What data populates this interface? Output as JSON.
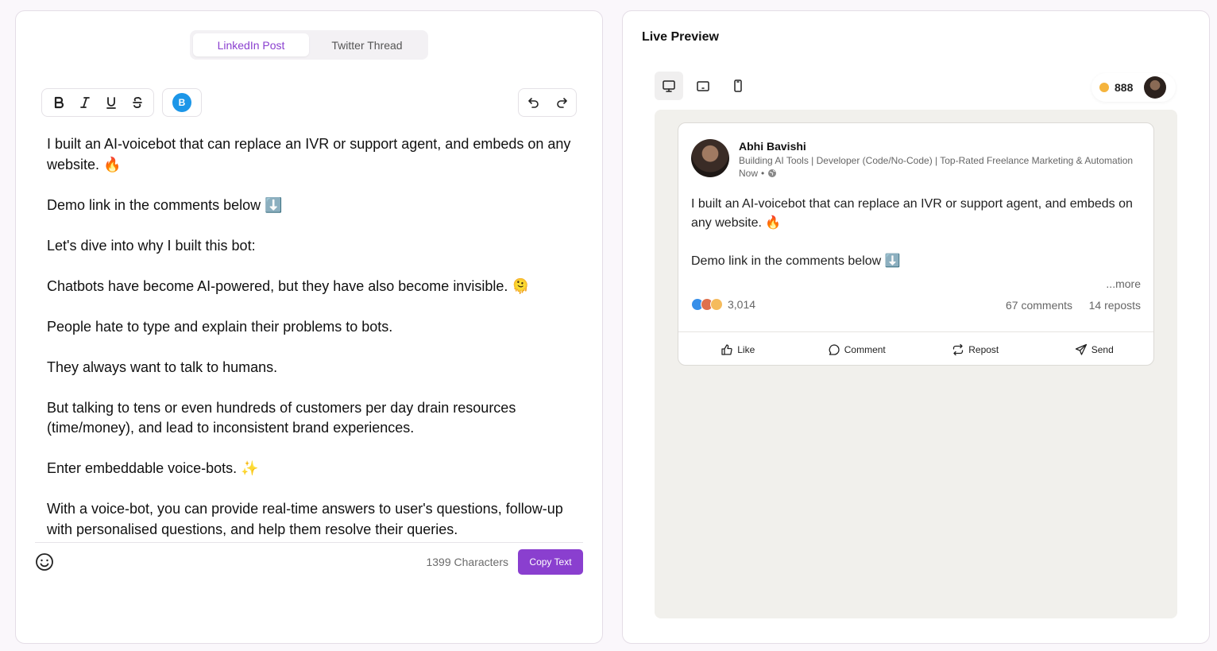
{
  "tabs": {
    "linkedin": "LinkedIn Post",
    "twitter": "Twitter Thread"
  },
  "toolbar": {
    "bold_icon": "bold-icon",
    "italic_icon": "italic-icon",
    "underline_icon": "underline-icon",
    "strikethrough_icon": "strikethrough-icon",
    "bold_font_label": "B",
    "undo_icon": "undo-icon",
    "redo_icon": "redo-icon"
  },
  "editor": {
    "paragraphs": [
      "I built an AI-voicebot that can replace an IVR or support agent, and embeds on any website. 🔥",
      "Demo link in the comments below ⬇️",
      "Let's dive into why I built this bot:",
      "Chatbots have become AI-powered, but they have also become invisible. 🫠",
      "People hate to type and explain their problems to bots.",
      "They always want to talk to humans.",
      "But talking to tens or even hundreds of customers per day drain resources (time/money), and lead to inconsistent brand experiences.",
      "Enter embeddable voice-bots. ✨",
      "With a voice-bot, you can provide real-time answers to user's questions, follow-up with personalised questions, and help them resolve their queries."
    ]
  },
  "footer": {
    "char_count": "1399 Characters",
    "copy_label": "Copy Text"
  },
  "preview": {
    "title": "Live Preview",
    "credits": "888",
    "author_name": "Abhi Bavishi",
    "author_headline": "Building AI Tools | Developer (Code/No-Code) | Top-Rated Freelance Marketing & Automation",
    "time": "Now",
    "body_line1": "I built an AI-voicebot that can replace an IVR or support agent, and embeds on any website. 🔥",
    "body_line2": "Demo link in the comments below ⬇️",
    "more": "...more",
    "reaction_count": "3,014",
    "comments": "67 comments",
    "reposts": "14 reposts",
    "actions": {
      "like": "Like",
      "comment": "Comment",
      "repost": "Repost",
      "send": "Send"
    }
  },
  "colors": {
    "accent": "#8a3fcf",
    "bold_font_badge": "#1c96e8",
    "coin": "#f5b43d"
  }
}
